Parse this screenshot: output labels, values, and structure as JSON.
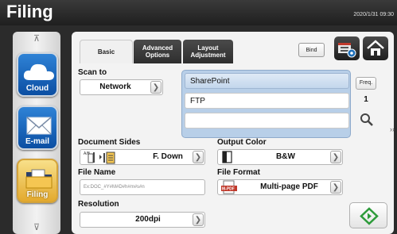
{
  "header": {
    "title": "Filing",
    "datetime": "2020/1/31 09:30"
  },
  "sidebar": {
    "items": [
      {
        "label": "Cloud",
        "icon": "cloud-icon"
      },
      {
        "label": "E-mail",
        "icon": "envelope-icon"
      },
      {
        "label": "Filing",
        "icon": "folder-icon",
        "active": true
      }
    ]
  },
  "tabs": [
    {
      "label": "Basic",
      "selected": true
    },
    {
      "label": "Advanced\nOptions",
      "selected": false
    },
    {
      "label": "Layout\nAdjustment",
      "selected": false
    }
  ],
  "toolbar": {
    "bind_label": "Bind",
    "profile_icon": "profile-settings-icon",
    "home_icon": "home-icon"
  },
  "scan_to": {
    "label": "Scan to",
    "value": "Network",
    "destinations": [
      "SharePoint",
      "FTP",
      ""
    ],
    "freq_label": "Freq.",
    "freq_count": "1"
  },
  "document_sides": {
    "label": "Document Sides",
    "value": "F. Down"
  },
  "output_color": {
    "label": "Output Color",
    "value": "B&W"
  },
  "file_name": {
    "label": "File Name",
    "value": "Ex:DOC_#Y#M#D#h#m#s#n"
  },
  "file_format": {
    "label": "File Format",
    "value": "Multi-page PDF",
    "icon_text": "M-PDF"
  },
  "resolution": {
    "label": "Resolution",
    "value": "200dpi"
  },
  "colors": {
    "accent_blue": "#0b4fa3",
    "active_gold": "#e3a92d",
    "start_green": "#2d9b3a"
  }
}
